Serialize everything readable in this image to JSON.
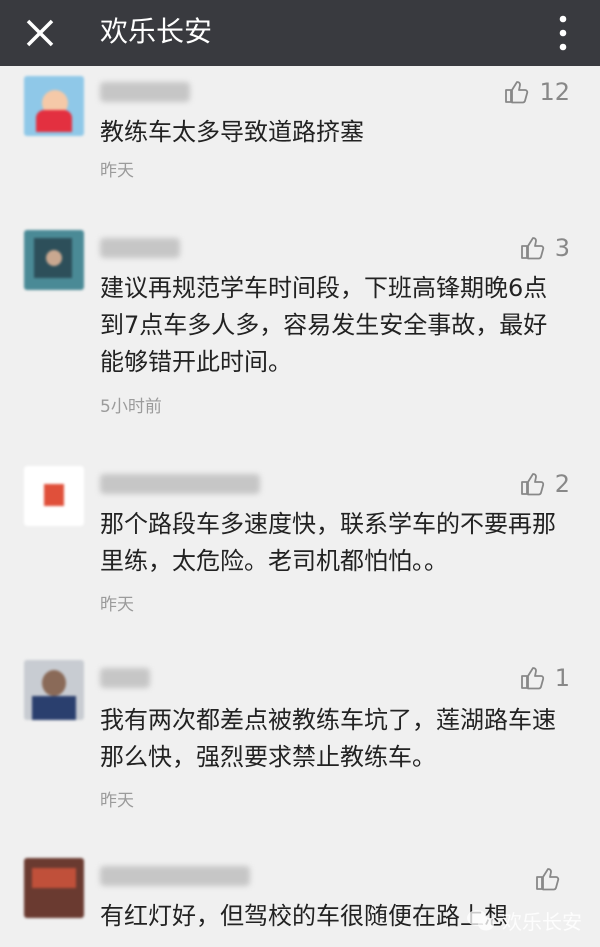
{
  "topbar": {
    "title": "欢乐长安",
    "close_icon": "close-icon",
    "more_icon": "more-vertical-icon"
  },
  "comments": [
    {
      "likes": "12",
      "text": "教练车太多导致道路挤塞",
      "time": "昨天"
    },
    {
      "likes": "3",
      "text": "建议再规范学车时间段，下班高锋期晚6点到7点车多人多，容易发生安全事故，最好能够错开此时间。",
      "time": "5小时前"
    },
    {
      "likes": "2",
      "text": "那个路段车多速度快，联系学车的不要再那里练，太危险。老司机都怕怕。。",
      "time": "昨天"
    },
    {
      "likes": "1",
      "text": "我有两次都差点被教练车坑了，莲湖路车速那么快，强烈要求禁止教练车。",
      "time": "昨天"
    },
    {
      "likes": "",
      "text": "有红灯好，但驾校的车很随便在路上想",
      "time": ""
    }
  ],
  "watermark": {
    "text": "欢乐长安",
    "icon": "wechat-icon"
  },
  "colors": {
    "topbar": "#393a3f",
    "background": "#f0f0f0",
    "secondary": "#9b9b9b",
    "like": "#888888"
  }
}
